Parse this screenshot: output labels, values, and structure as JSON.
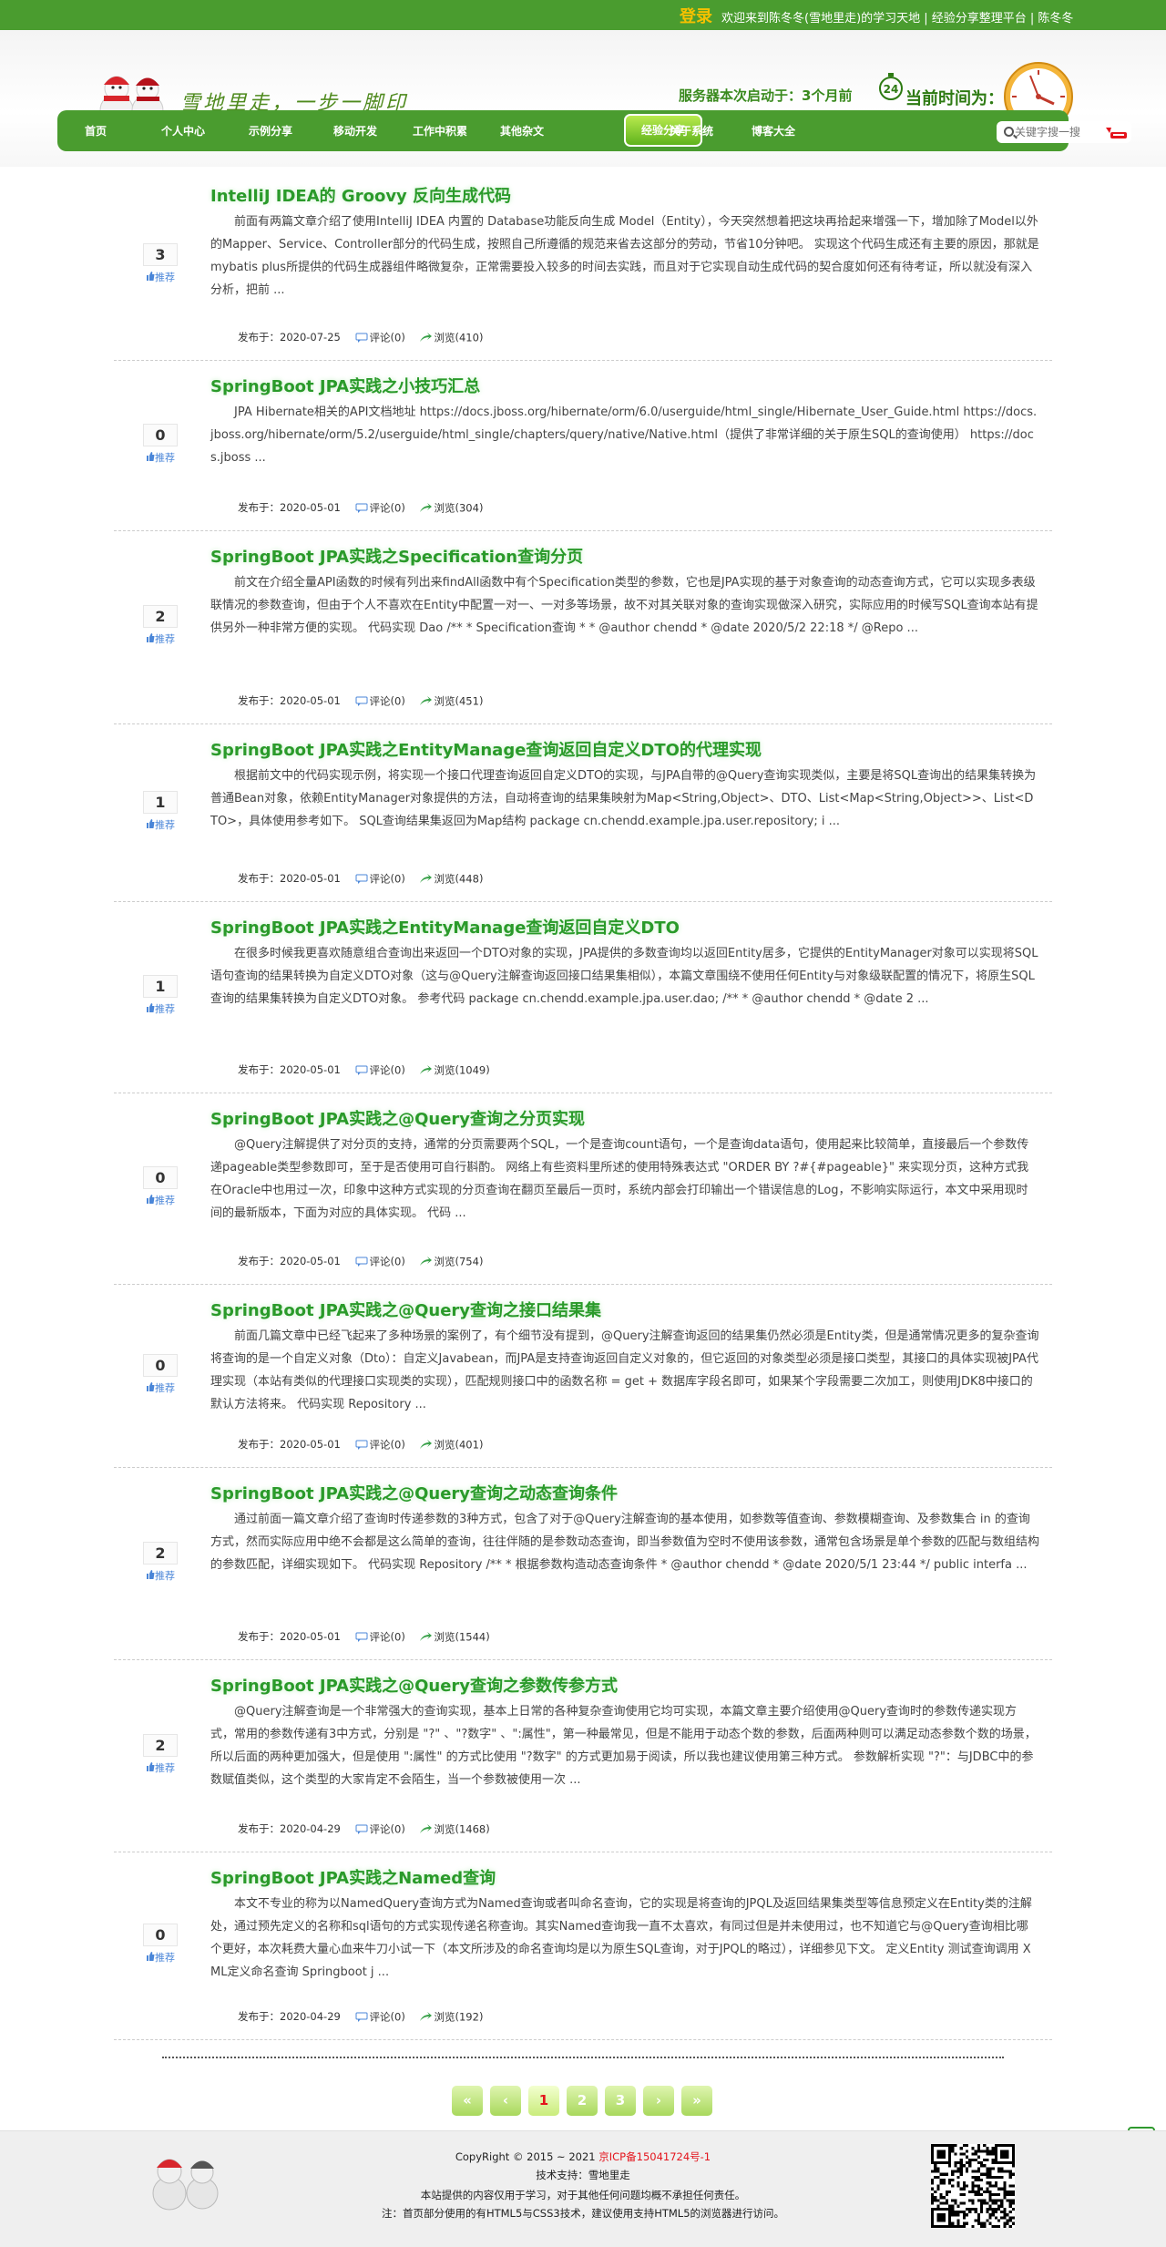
{
  "topbar": {
    "login_label": "登录",
    "welcome": "欢迎来到陈冬冬(雪地里走)的学习天地 | 经验分享整理平台 | 陈冬冬"
  },
  "header": {
    "logo_text": "雪地里走，一步一脚印",
    "server_prefix": "服务器本次启动于：",
    "server_value": "3个月前",
    "stopwatch_number": "24",
    "clock_label": "当前时间为："
  },
  "nav": {
    "items": [
      "首页",
      "个人中心",
      "示例分享",
      "移动开发",
      "工作中积累",
      "其他杂文",
      "经验分享",
      "关于系统",
      "博客大全"
    ],
    "active": "经验分享",
    "search_placeholder": "关键字搜一搜"
  },
  "articles": [
    {
      "votes": "3",
      "title": "IntelliJ IDEA的 Groovy 反向生成代码",
      "summary": "前面有两篇文章介绍了使用IntelliJ IDEA 内置的 Database功能反向生成 Model（Entity），今天突然想着把这块再拾起来增强一下，增加除了Model以外的Mapper、Service、Controller部分的代码生成，按照自己所遵循的规范来省去这部分的劳动，节省10分钟吧。 实现这个代码生成还有主要的原因，那就是mybatis plus所提供的代码生成器组件略微复杂，正常需要投入较多的时间去实践，而且对于它实现自动生成代码的契合度如何还有待考证，所以就没有深入分析，把前 ...",
      "date": "2020-07-25",
      "comments": "0",
      "views": "410"
    },
    {
      "votes": "0",
      "title": "SpringBoot JPA实践之小技巧汇总",
      "summary": "JPA Hibernate相关的API文档地址 https://docs.jboss.org/hibernate/orm/6.0/userguide/html_single/Hibernate_User_Guide.html https://docs.jboss.org/hibernate/orm/5.2/userguide/html_single/chapters/query/native/Native.html（提供了非常详细的关于原生SQL的查询使用） https://docs.jboss ...",
      "date": "2020-05-01",
      "comments": "0",
      "views": "304"
    },
    {
      "votes": "2",
      "title": "SpringBoot JPA实践之Specification查询分页",
      "summary": "前文在介绍全量API函数的时候有列出来findAll函数中有个Specification类型的参数，它也是JPA实现的基于对象查询的动态查询方式，它可以实现多表级联情况的参数查询，但由于个人不喜欢在Entity中配置一对一、一对多等场景，故不对其关联对象的查询实现做深入研究，实际应用的时候写SQL查询本站有提供另外一种非常方便的实现。 代码实现 Dao /** * Specification查询 * * @author chendd * @date 2020/5/2 22:18 */ @Repo ...",
      "date": "2020-05-01",
      "comments": "0",
      "views": "451"
    },
    {
      "votes": "1",
      "title": "SpringBoot JPA实践之EntityManage查询返回自定义DTO的代理实现",
      "summary": "根据前文中的代码实现示例，将实现一个接口代理查询返回自定义DTO的实现，与JPA自带的@Query查询实现类似，主要是将SQL查询出的结果集转换为普通Bean对象，依赖EntityManager对象提供的方法，自动将查询的结果集映射为Map<String,Object>、DTO、List<Map<String,Object>>、List<DTO>，具体使用参考如下。 SQL查询结果集返回为Map结构 package cn.chendd.example.jpa.user.repository; i ...",
      "date": "2020-05-01",
      "comments": "0",
      "views": "448"
    },
    {
      "votes": "1",
      "title": "SpringBoot JPA实践之EntityManage查询返回自定义DTO",
      "summary": "在很多时候我更喜欢随意组合查询出来返回一个DTO对象的实现，JPA提供的多数查询均以返回Entity居多，它提供的EntityManager对象可以实现将SQL语句查询的结果转换为自定义DTO对象（这与@Query注解查询返回接口结果集相似），本篇文章围绕不使用任何Entity与对象级联配置的情况下，将原生SQL查询的结果集转换为自定义DTO对象。 参考代码 package cn.chendd.example.jpa.user.dao; /** * @author chendd * @date 2 ...",
      "date": "2020-05-01",
      "comments": "0",
      "views": "1049"
    },
    {
      "votes": "0",
      "title": "SpringBoot JPA实践之@Query查询之分页实现",
      "summary": "@Query注解提供了对分页的支持，通常的分页需要两个SQL，一个是查询count语句，一个是查询data语句，使用起来比较简单，直接最后一个参数传递pageable类型参数即可，至于是否使用可自行斟酌。 网络上有些资料里所述的使用特殊表达式 \"ORDER BY ?#{#pageable}\" 来实现分页，这种方式我在Oracle中也用过一次，印象中这种方式实现的分页查询在翻页至最后一页时，系统内部会打印输出一个错误信息的Log，不影响实际运行，本文中采用现时间的最新版本，下面为对应的具体实现。 代码 ...",
      "date": "2020-05-01",
      "comments": "0",
      "views": "754"
    },
    {
      "votes": "0",
      "title": "SpringBoot JPA实践之@Query查询之接口结果集",
      "summary": "前面几篇文章中已经飞起来了多种场景的案例了，有个细节没有提到，@Query注解查询返回的结果集仍然必须是Entity类，但是通常情况更多的复杂查询将查询的是一个自定义对象（Dto）：自定义Javabean，而JPA是支持查询返回自定义对象的，但它返回的对象类型必须是接口类型，其接口的具体实现被JPA代理实现（本站有类似的代理接口实现类的实现），匹配规则接口中的函数名称 = get + 数据库字段名即可，如果某个字段需要二次加工，则使用JDK8中接口的默认方法将来。 代码实现 Repository ...",
      "date": "2020-05-01",
      "comments": "0",
      "views": "401"
    },
    {
      "votes": "2",
      "title": "SpringBoot JPA实践之@Query查询之动态查询条件",
      "summary": "通过前面一篇文章介绍了查询时传递参数的3种方式，包含了对于@Query注解查询的基本使用，如参数等值查询、参数模糊查询、及参数集合 in 的查询方式，然而实际应用中绝不会都是这么简单的查询，往往伴随的是参数动态查询，即当参数值为空时不使用该参数，通常包含场景是单个参数的匹配与数组结构的参数匹配，详细实现如下。 代码实现 Repository /** * 根据参数构造动态查询条件 * @author chendd * @date 2020/5/1 23:44 */ public interfa ...",
      "date": "2020-05-01",
      "comments": "0",
      "views": "1544"
    },
    {
      "votes": "2",
      "title": "SpringBoot JPA实践之@Query查询之参数传参方式",
      "summary": "@Query注解查询是一个非常强大的查询实现，基本上日常的各种复杂查询使用它均可实现，本篇文章主要介绍使用@Query查询时的参数传递实现方式，常用的参数传递有3中方式，分别是 \"?\" 、\"?数字\" 、\":属性\"，第一种最常见，但是不能用于动态个数的参数，后面两种则可以满足动态参数个数的场景，所以后面的两种更加强大，但是使用 \":属性\" 的方式比使用 \"?数字\" 的方式更加易于阅读，所以我也建议使用第三种方式。 参数解析实现 \"?\"：与JDBC中的参数赋值类似，这个类型的大家肯定不会陌生，当一个参数被使用一次 ...",
      "date": "2020-04-29",
      "comments": "0",
      "views": "1468"
    },
    {
      "votes": "0",
      "title": "SpringBoot JPA实践之Named查询",
      "summary": "本文不专业的称为以NamedQuery查询方式为Named查询或者叫命名查询，它的实现是将查询的JPQL及返回结果集类型等信息预定义在Entity类的注解处，通过预先定义的名称和sql语句的方式实现传递名称查询。其实Named查询我一直不太喜欢，有同过但是并未使用过，也不知道它与@Query查询相比哪个更好，本次耗费大量心血来牛刀小试一下（本文所涉及的命名查询均是以为原生SQL查询，对于JPQL的略过），详细参见下文。 定义Entity 测试查询调用 XML定义命名查询 Springboot j ...",
      "date": "2020-04-29",
      "comments": "0",
      "views": "192"
    }
  ],
  "labels": {
    "recommend": "推荐",
    "published": "发布于：",
    "comment": "评论",
    "views": "浏览"
  },
  "pagination": [
    "«",
    "‹",
    "1",
    "2",
    "3",
    "›",
    "»"
  ],
  "pagination_current": "1",
  "footer": {
    "copyright_prefix": "CopyRight © 2015 ~ 2021",
    "icp": "京ICP备15041724号-1",
    "support": "技术支持：雪地里走",
    "note1": "本站提供的内容仅用于学习，对于其他任何问题均概不承担任何责任。",
    "note2": "注：首页部分使用的有HTML5与CSS3技术，建议使用支持HTML5的浏览器进行访问。"
  },
  "colors": {
    "brand_green": "#4a9c2f",
    "title_green": "#2a9a2a",
    "accent_yellow": "#f5c000",
    "icp_red": "#e4141c"
  }
}
